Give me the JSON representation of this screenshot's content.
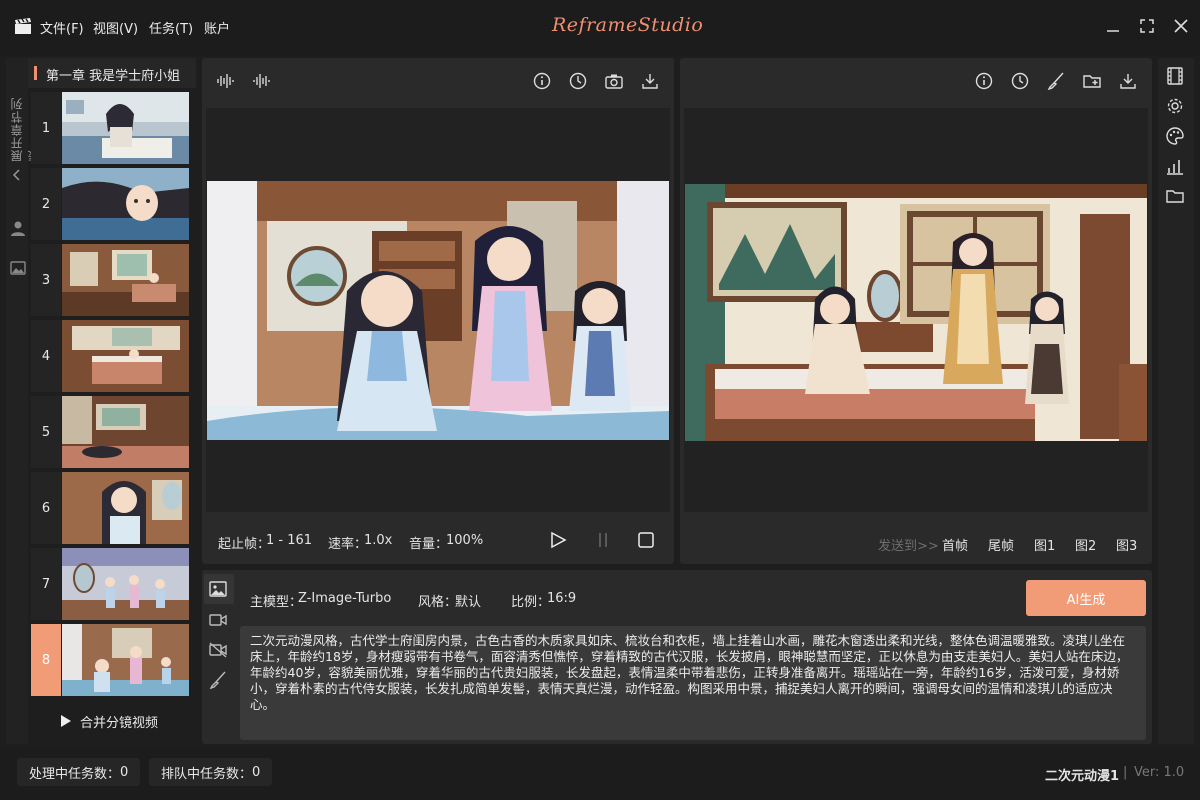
{
  "app": {
    "logo": "ReframeStudio",
    "menu": [
      "文件(F)",
      "视图(V)",
      "任务(T)",
      "账户"
    ]
  },
  "sidebar": {
    "expand_label": "展开章节列表"
  },
  "chapter": {
    "title": "第一章 我是学士府小姐",
    "shots": [
      {
        "num": "1",
        "scene": "reading-girl"
      },
      {
        "num": "2",
        "scene": "lying-girl"
      },
      {
        "num": "3",
        "scene": "room-wide"
      },
      {
        "num": "4",
        "scene": "bedroom"
      },
      {
        "num": "5",
        "scene": "sleeping"
      },
      {
        "num": "6",
        "scene": "portrait"
      },
      {
        "num": "7",
        "scene": "three-girls"
      },
      {
        "num": "8",
        "scene": "three-girls-wide",
        "active": true
      }
    ],
    "merge_label": "合并分镜视频"
  },
  "left_panel": {
    "frame_range_label": "起止帧：",
    "frame_range": "1 - 161",
    "speed_label": "速率：",
    "speed": "1.0x",
    "volume_label": "音量：",
    "volume": "100%"
  },
  "right_panel": {
    "send_to": "发送到>>",
    "targets": [
      "首帧",
      "尾帧",
      "图1",
      "图2",
      "图3"
    ]
  },
  "generator": {
    "model_label": "主模型：",
    "model": "Z-Image-Turbo",
    "style_label": "风格：",
    "style": "默认",
    "ratio_label": "比例：",
    "ratio": "16:9",
    "generate_button": "AI生成",
    "prompt": "二次元动漫风格，古代学士府闺房内景，古色古香的木质家具如床、梳妆台和衣柜，墙上挂着山水画，雕花木窗透出柔和光线，整体色调温暖雅致。凌琪儿坐在床上，年龄约18岁，身材瘦弱带有书卷气，面容清秀但憔悴，穿着精致的古代汉服，长发披肩，眼神聪慧而坚定，正以休息为由支走美妇人。美妇人站在床边，年龄约40岁，容貌美丽优雅，穿着华丽的古代贵妇服装，长发盘起，表情温柔中带着悲伤，正转身准备离开。瑶瑶站在一旁，年龄约16岁，活泼可爱，身材娇小，穿着朴素的古代侍女服装，长发扎成简单发髻，表情天真烂漫，动作轻盈。构图采用中景，捕捉美妇人离开的瞬间，强调母女间的温情和凌琪儿的适应决心。"
  },
  "status": {
    "processing_label": "处理中任务数：",
    "processing": "0",
    "queued_label": "排队中任务数：",
    "queued": "0",
    "project": "二次元动漫1",
    "separator": "|",
    "version": "Ver: 1.0"
  },
  "colors": {
    "accent": "#f29c77",
    "bg": "#1e1e1e",
    "panel": "#2a2a2a"
  }
}
